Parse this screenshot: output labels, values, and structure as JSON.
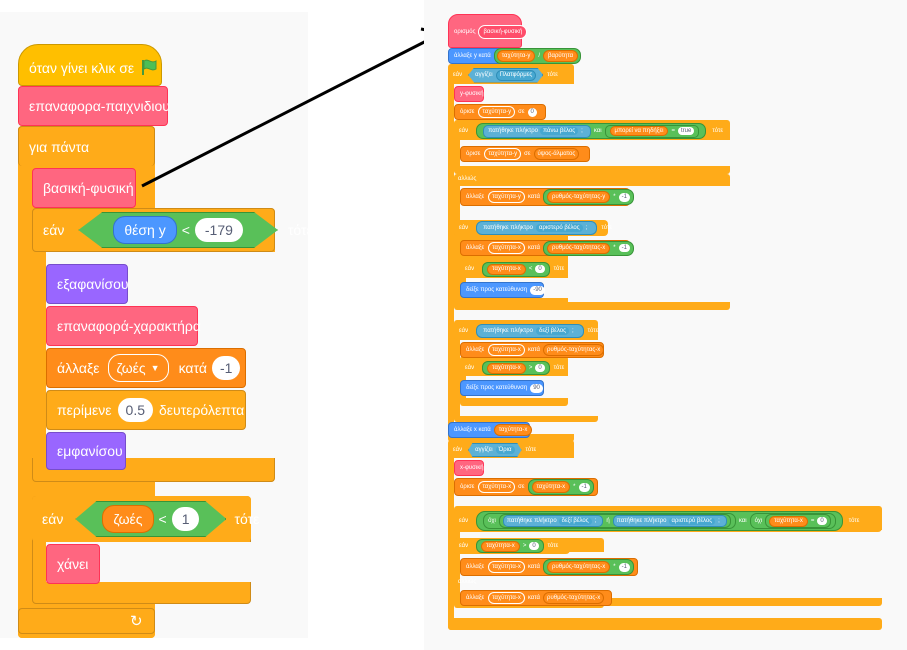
{
  "left": {
    "hat": {
      "text": "όταν γίνει κλικ σε",
      "icon": "green-flag-icon"
    },
    "reset_game": "επαναφορα-παιχνιδιου",
    "forever": "για πάντα",
    "basic_physics": "βασική-φυσική",
    "if1": {
      "if": "εάν",
      "then": "τότε",
      "reporter": "θέση y",
      "op": "<",
      "value": "-179"
    },
    "hide": "εξαφανίσου",
    "reset_char": "επαναφορά-χαρακτήρα",
    "change": {
      "label": "άλλαξε",
      "var": "ζωές",
      "by": "κατά",
      "value": "-1"
    },
    "wait": {
      "label": "περίμενε",
      "value": "0.5",
      "unit": "δευτερόλεπτα"
    },
    "show": "εμφανίσου",
    "if2": {
      "if": "εάν",
      "then": "τότε",
      "reporter": "ζωές",
      "op": "<",
      "value": "1"
    },
    "lose": "χάνει"
  },
  "right": {
    "define": {
      "label": "ορισμός",
      "name": "βασική-φυσική"
    },
    "r1": {
      "a": "άλλαξε y κατά",
      "b": "ταχύτητα-y",
      "op": "/",
      "c": "βαρύτητα"
    },
    "r2": {
      "a": "εάν",
      "b": "αγγίζει",
      "c": "Πλατφόρμες",
      "d": "τότε"
    },
    "r3": "y-φυσική",
    "r4": {
      "a": "όρισε",
      "b": "ταχύτητα-y",
      "c": "σε",
      "d": "0"
    },
    "r5": {
      "a": "εάν",
      "b": "πατήθηκε πλήκτρο",
      "c": "πάνω βέλος",
      "d": ";",
      "e": "και",
      "f": "μπορεί να πηδήξει",
      "g": "=",
      "h": "true",
      "i": "τότε"
    },
    "r6": {
      "a": "όρισε",
      "b": "ταχύτητα-y",
      "c": "σε",
      "d": "ύψος-άλματος"
    },
    "r7": "αλλιώς",
    "r8": {
      "a": "άλλαξε",
      "b": "ταχύτητα-y",
      "c": "κατά",
      "d": "ρυθμός-ταχύτητας-y",
      "e": "*",
      "f": "-1"
    },
    "r9": {
      "a": "εάν",
      "b": "πατήθηκε πλήκτρο",
      "c": "αριστερό βέλος",
      "d": ";",
      "e": "τότε"
    },
    "r10": {
      "a": "άλλαξε",
      "b": "ταχύτητα-x",
      "c": "κατά",
      "d": "ρυθμός-ταχύτητας-x",
      "e": "*",
      "f": "-1"
    },
    "r11": {
      "a": "εάν",
      "b": "ταχύτητα-x",
      "c": "<",
      "d": "0",
      "e": "τότε"
    },
    "r12": {
      "a": "δείξε προς κατεύθυνση",
      "b": "-90"
    },
    "r13": {
      "a": "εάν",
      "b": "πατήθηκε πλήκτρο",
      "c": "δεξί βέλος",
      "d": ";",
      "e": "τότε"
    },
    "r14": {
      "a": "άλλαξε",
      "b": "ταχύτητα-x",
      "c": "κατά",
      "d": "ρυθμός-ταχύτητας-x"
    },
    "r15": {
      "a": "εάν",
      "b": "ταχύτητα-x",
      "c": ">",
      "d": "0",
      "e": "τότε"
    },
    "r16": {
      "a": "δείξε προς κατεύθυνση",
      "b": "90"
    },
    "r17": {
      "a": "άλλαξε x κατά",
      "b": "ταχύτητα-x"
    },
    "r18": {
      "a": "εάν",
      "b": "αγγίζει",
      "c": "Όρια",
      "d": "τότε"
    },
    "r19": "x-φυσική",
    "r20": {
      "a": "όρισε",
      "b": "ταχύτητα-x",
      "c": "σε",
      "d": "ταχύτητα-x",
      "e": "*",
      "f": "-1"
    },
    "r21": {
      "a": "εάν",
      "b": "όχι",
      "c": "πατήθηκε πλήκτρο",
      "d": "δεξί βέλος",
      "e": ";",
      "f": "ή",
      "g": "πατήθηκε πλήκτρο",
      "h": "αριστερό βέλος",
      "i": ";",
      "j": "και",
      "k": "όχι",
      "l": "ταχύτητα-x",
      "m": "=",
      "n": "0",
      "o": "τότε"
    },
    "r22": {
      "a": "εάν",
      "b": "ταχύτητα-x",
      "c": ">",
      "d": "0",
      "e": "τότε"
    },
    "r23": {
      "a": "άλλαξε",
      "b": "ταχύτητα-x",
      "c": "κατά",
      "d": "ρυθμός-ταχύτητας-x",
      "e": "*",
      "f": "-1"
    },
    "r24": "αλλιώς",
    "r25": {
      "a": "άλλαξε",
      "b": "ταχύτητα-x",
      "c": "κατά",
      "d": "ρυθμός-ταχύτητας-x"
    }
  },
  "colors": {
    "events": "#ffbf00",
    "control": "#ffab19",
    "myblocks": "#ff6680",
    "variables": "#ff8c1a",
    "looks": "#9966ff",
    "motion": "#4c97ff",
    "sensing": "#5cb1d6",
    "operators": "#59c059"
  }
}
